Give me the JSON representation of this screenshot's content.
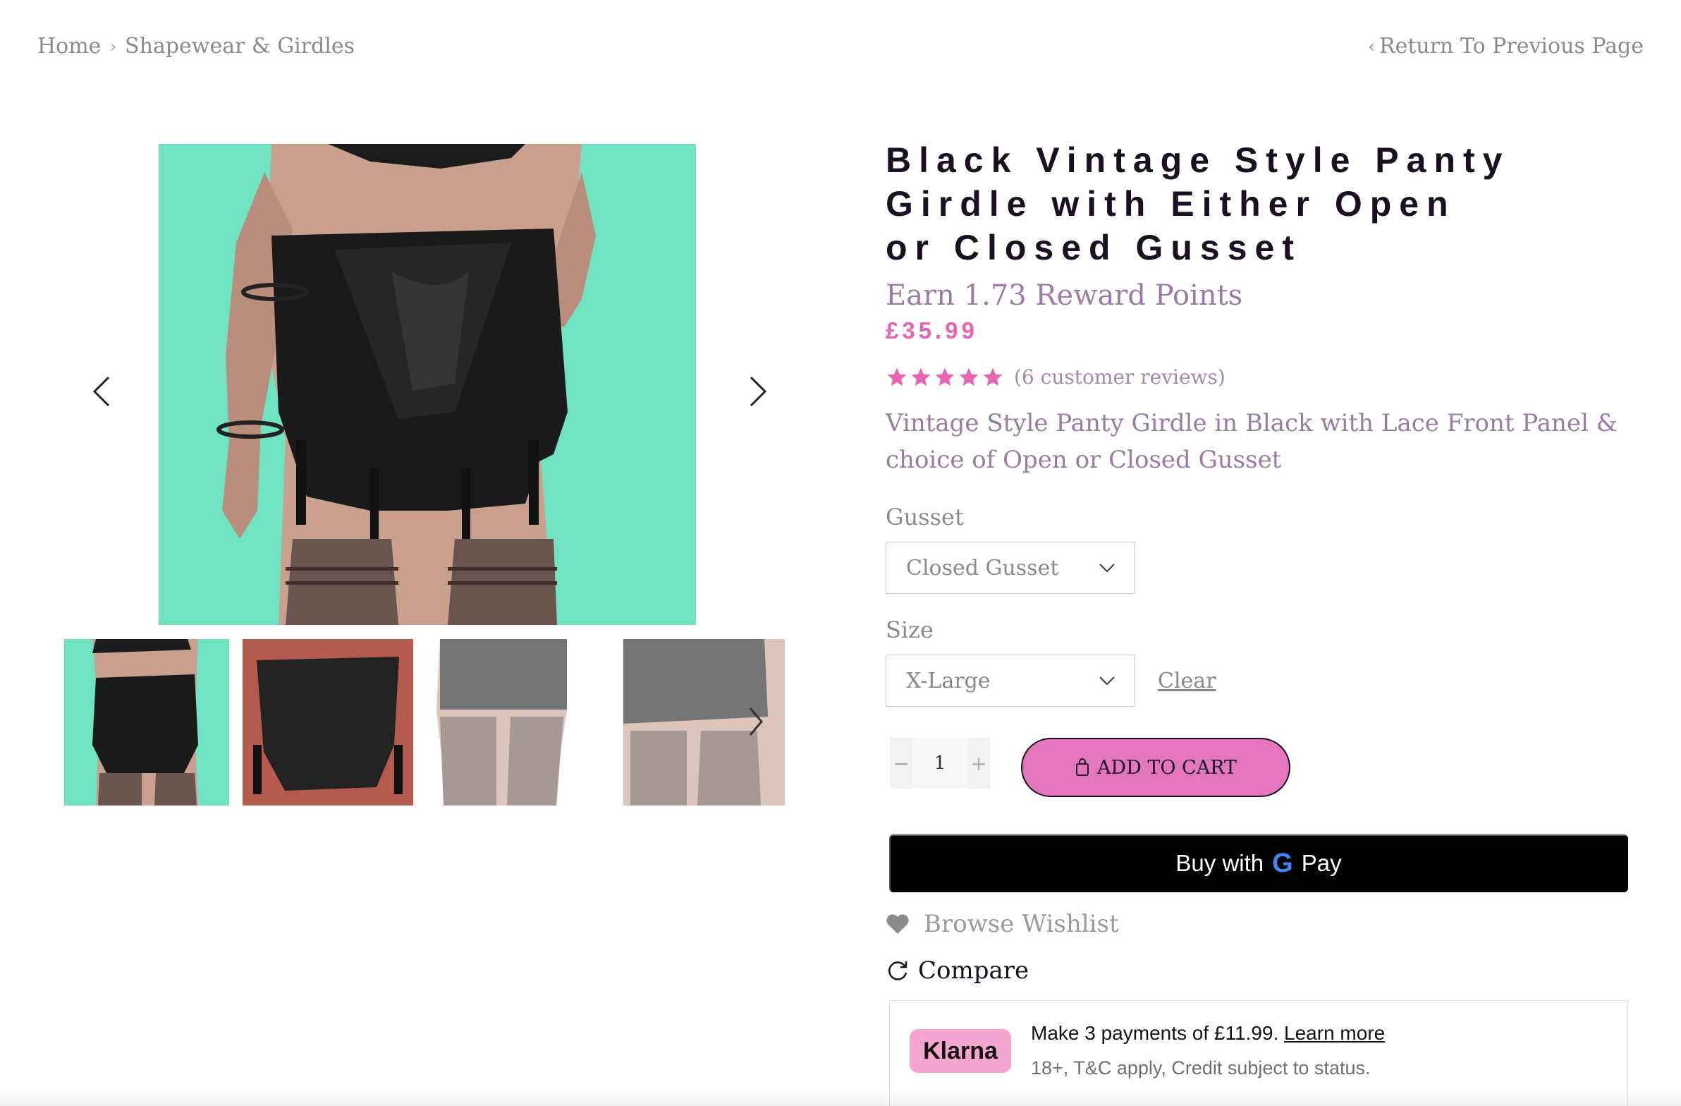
{
  "breadcrumb": {
    "home": "Home",
    "separator": "›",
    "category": "Shapewear & Girdles"
  },
  "return_link": {
    "chevron": "‹",
    "label": "Return To Previous Page"
  },
  "product": {
    "title": "Black Vintage Style Panty Girdle with Either Open or Closed Gusset",
    "reward": "Earn 1.73 Reward Points",
    "price": "£35.99",
    "rating": {
      "stars": 5,
      "max": 5,
      "reviews_label": "(6 customer reviews)"
    },
    "description": "Vintage Style Panty Girdle in Black with Lace Front Panel & choice of Open or Closed Gusset"
  },
  "options": {
    "gusset": {
      "label": "Gusset",
      "selected": "Closed Gusset"
    },
    "size": {
      "label": "Size",
      "selected": "X-Large",
      "clear_label": "Clear"
    }
  },
  "quantity": {
    "minus": "−",
    "value": "1",
    "plus": "+"
  },
  "add_to_cart": {
    "label": "ADD TO CART",
    "icon": "shopping-bag-icon"
  },
  "gpay": {
    "prefix": "Buy with",
    "brand_g": "G",
    "brand_pay": "Pay"
  },
  "wishlist": {
    "label": "Browse Wishlist",
    "icon": "heart-icon"
  },
  "compare": {
    "label": "Compare",
    "icon": "refresh-icon"
  },
  "klarna": {
    "badge": "Klarna",
    "message": "Make 3 payments of £11.99.",
    "learn_more": "Learn more",
    "disclaimer": "18+, T&C apply, Credit subject to status."
  },
  "colors": {
    "accent_pink": "#e565b3",
    "cart_pink": "#e376bd",
    "muted_purple": "#9b7aa3",
    "title_dark": "#1a1022",
    "klarna_pink": "#f3a6cf",
    "image_bg_mint": "#70e3c2",
    "image_bg_terracotta": "#b55b4e"
  }
}
